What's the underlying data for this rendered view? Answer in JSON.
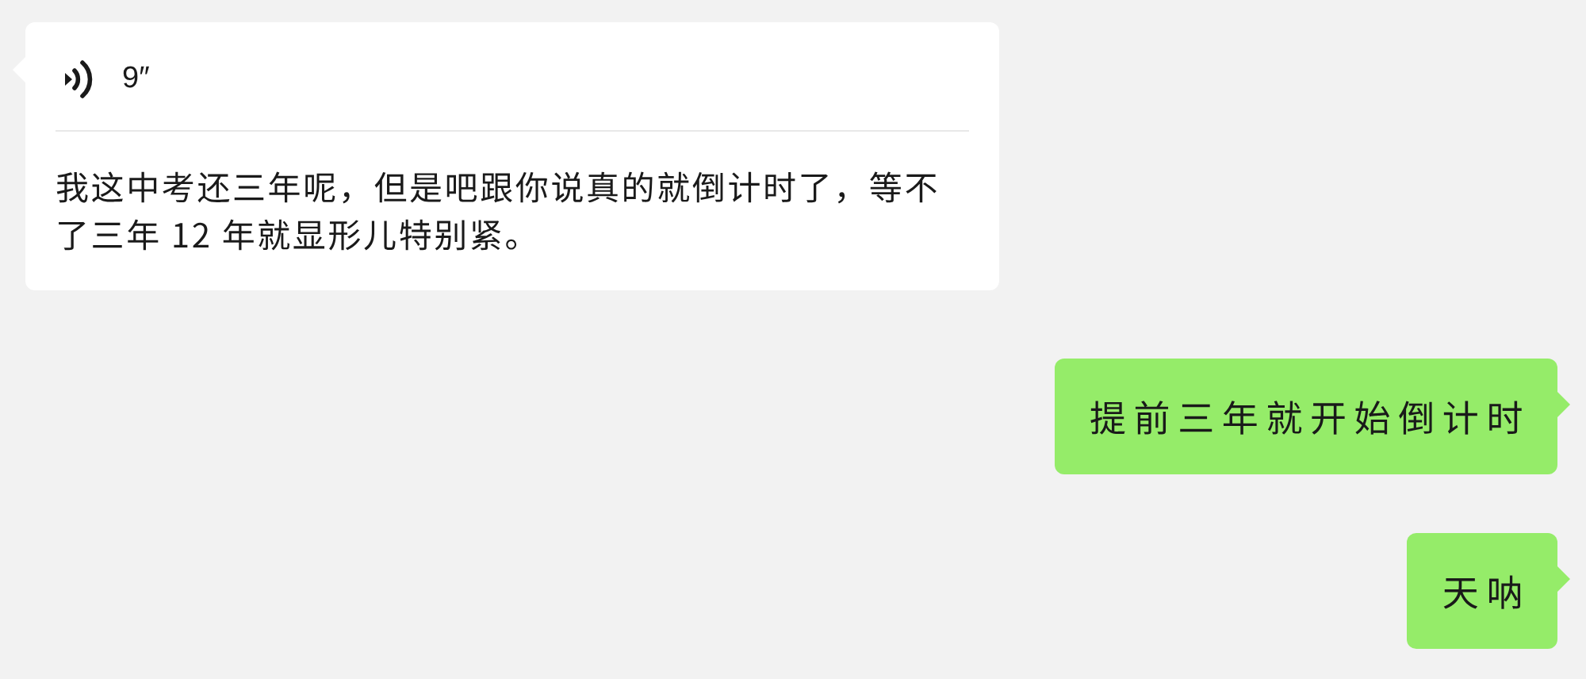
{
  "messages": [
    {
      "kind": "voice",
      "from_me": false,
      "duration": "9″",
      "transcript": "我这中考还三年呢，但是吧跟你说真的就倒计时了，等不了三年 12 年就显形儿特别紧。"
    },
    {
      "kind": "text",
      "from_me": true,
      "text": "提前三年就开始倒计时"
    },
    {
      "kind": "text",
      "from_me": true,
      "text": "天呐"
    }
  ]
}
